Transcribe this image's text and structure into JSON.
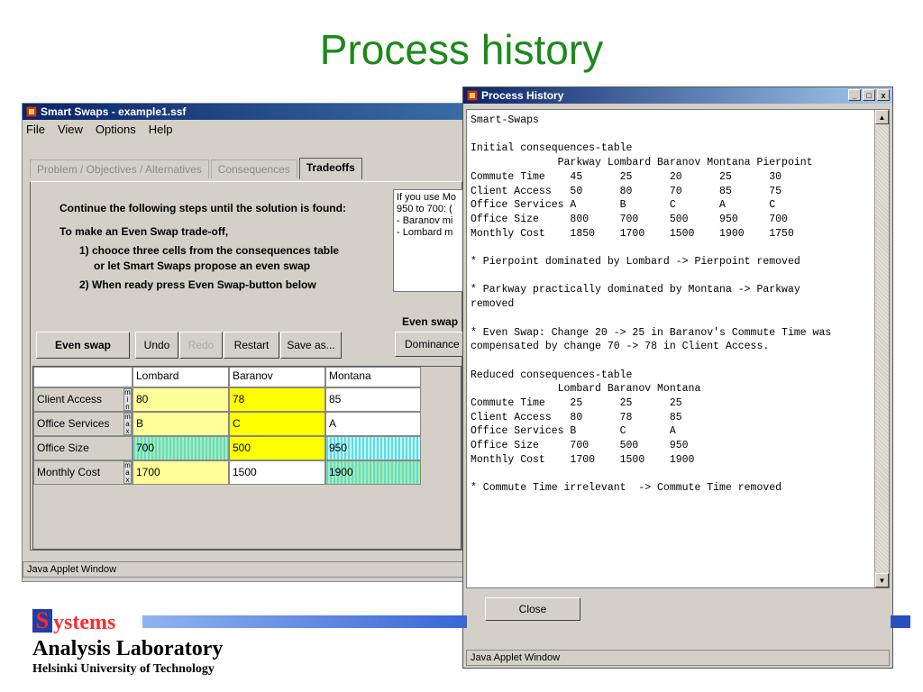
{
  "slide": {
    "title": "Process history"
  },
  "colors": {
    "slide_title": "#1a8a1a",
    "titlebar": "#0a246a",
    "logo_red": "#ff2a2a",
    "logo_blue": "#1f3fa8"
  },
  "main_window": {
    "title": "Smart Swaps - example1.ssf",
    "menu": [
      "File",
      "View",
      "Options",
      "Help"
    ],
    "tabs": [
      {
        "label": "Problem / Objectives / Alternatives",
        "active": false
      },
      {
        "label": "Consequences",
        "active": false
      },
      {
        "label": "Tradeoffs",
        "active": true
      }
    ],
    "instructions": [
      "Continue the following steps until the solution is found:",
      "To make an Even Swap trade-off,",
      "1) chooce three cells from the consequences table",
      "or let Smart Swaps propose an even swap",
      "2) When ready press Even Swap-button below"
    ],
    "note_lines": [
      "If you use Mo",
      "950 to 700: (",
      "- Baranov mi",
      "- Lombard m"
    ],
    "even_swap_label": "Even swap",
    "buttons": {
      "even_swap": "Even swap",
      "undo": "Undo",
      "redo": "Redo",
      "restart": "Restart",
      "save_as": "Save as...",
      "dominance": "Dominance"
    },
    "table": {
      "columns": [
        "Lombard",
        "Baranov",
        "Montana"
      ],
      "rows": [
        {
          "label": "Client Access",
          "side": "m i n",
          "values": [
            "80",
            "78",
            "85"
          ]
        },
        {
          "label": "Office Services",
          "side": "m a x",
          "values": [
            "B",
            "C",
            "A"
          ]
        },
        {
          "label": "Office Size",
          "side": "",
          "values": [
            "700",
            "500",
            "950"
          ]
        },
        {
          "label": "Monthly Cost",
          "side": "m a x",
          "values": [
            "1700",
            "1500",
            "1900"
          ]
        }
      ]
    },
    "status": "Java Applet Window"
  },
  "history_window": {
    "title": "Process History",
    "controls": {
      "minimize": "_",
      "maximize": "□",
      "close": "x"
    },
    "log": "Smart-Swaps\n\nInitial consequences-table\n              Parkway Lombard Baranov Montana Pierpoint\nCommute Time    45      25      20      25      30\nClient Access   50      80      70      85      75\nOffice Services A       B       C       A       C\nOffice Size     800     700     500     950     700\nMonthly Cost    1850    1700    1500    1900    1750\n\n* Pierpoint dominated by Lombard -> Pierpoint removed\n\n* Parkway practically dominated by Montana -> Parkway\nremoved\n\n* Even Swap: Change 20 -> 25 in Baranov's Commute Time was\ncompensated by change 70 -> 78 in Client Access.\n\nReduced consequences-table\n              Lombard Baranov Montana\nCommute Time    25      25      25\nClient Access   80      78      85\nOffice Services B       C       A\nOffice Size     700     500     950\nMonthly Cost    1700    1500    1900\n\n* Commute Time irrelevant  -> Commute Time removed",
    "close_button": "Close",
    "status": "Java Applet Window"
  },
  "logo": {
    "s": "S",
    "ystems": "ystems",
    "line1": "Analysis Laboratory",
    "line2": "Helsinki University of Technology"
  }
}
